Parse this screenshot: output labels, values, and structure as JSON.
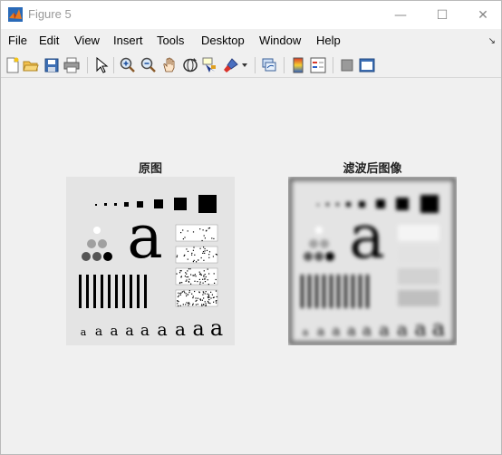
{
  "window": {
    "title": "Figure 5"
  },
  "window_controls": {
    "minimize": "—",
    "maximize": "☐",
    "close": "✕"
  },
  "menubar": {
    "items": [
      "File",
      "Edit",
      "View",
      "Insert",
      "Tools",
      "Desktop",
      "Window",
      "Help"
    ],
    "dock_arrow": "↘"
  },
  "toolbar": {
    "icons": [
      "new-figure-icon",
      "open-file-icon",
      "save-icon",
      "print-icon",
      "pointer-icon",
      "zoom-in-icon",
      "zoom-out-icon",
      "pan-icon",
      "rotate-3d-icon",
      "data-cursor-icon",
      "brush-icon",
      "link-plot-icon",
      "colorbar-icon",
      "legend-icon",
      "hide-plot-tools-icon",
      "show-plot-tools-icon"
    ]
  },
  "figure": {
    "left_title": "原图",
    "right_title": "滤波后图像",
    "sample_letter": "a"
  },
  "colors": {
    "panel_bg": "#e4e4e4",
    "ink": "#000000",
    "window_bg": "#f0f0f0"
  }
}
